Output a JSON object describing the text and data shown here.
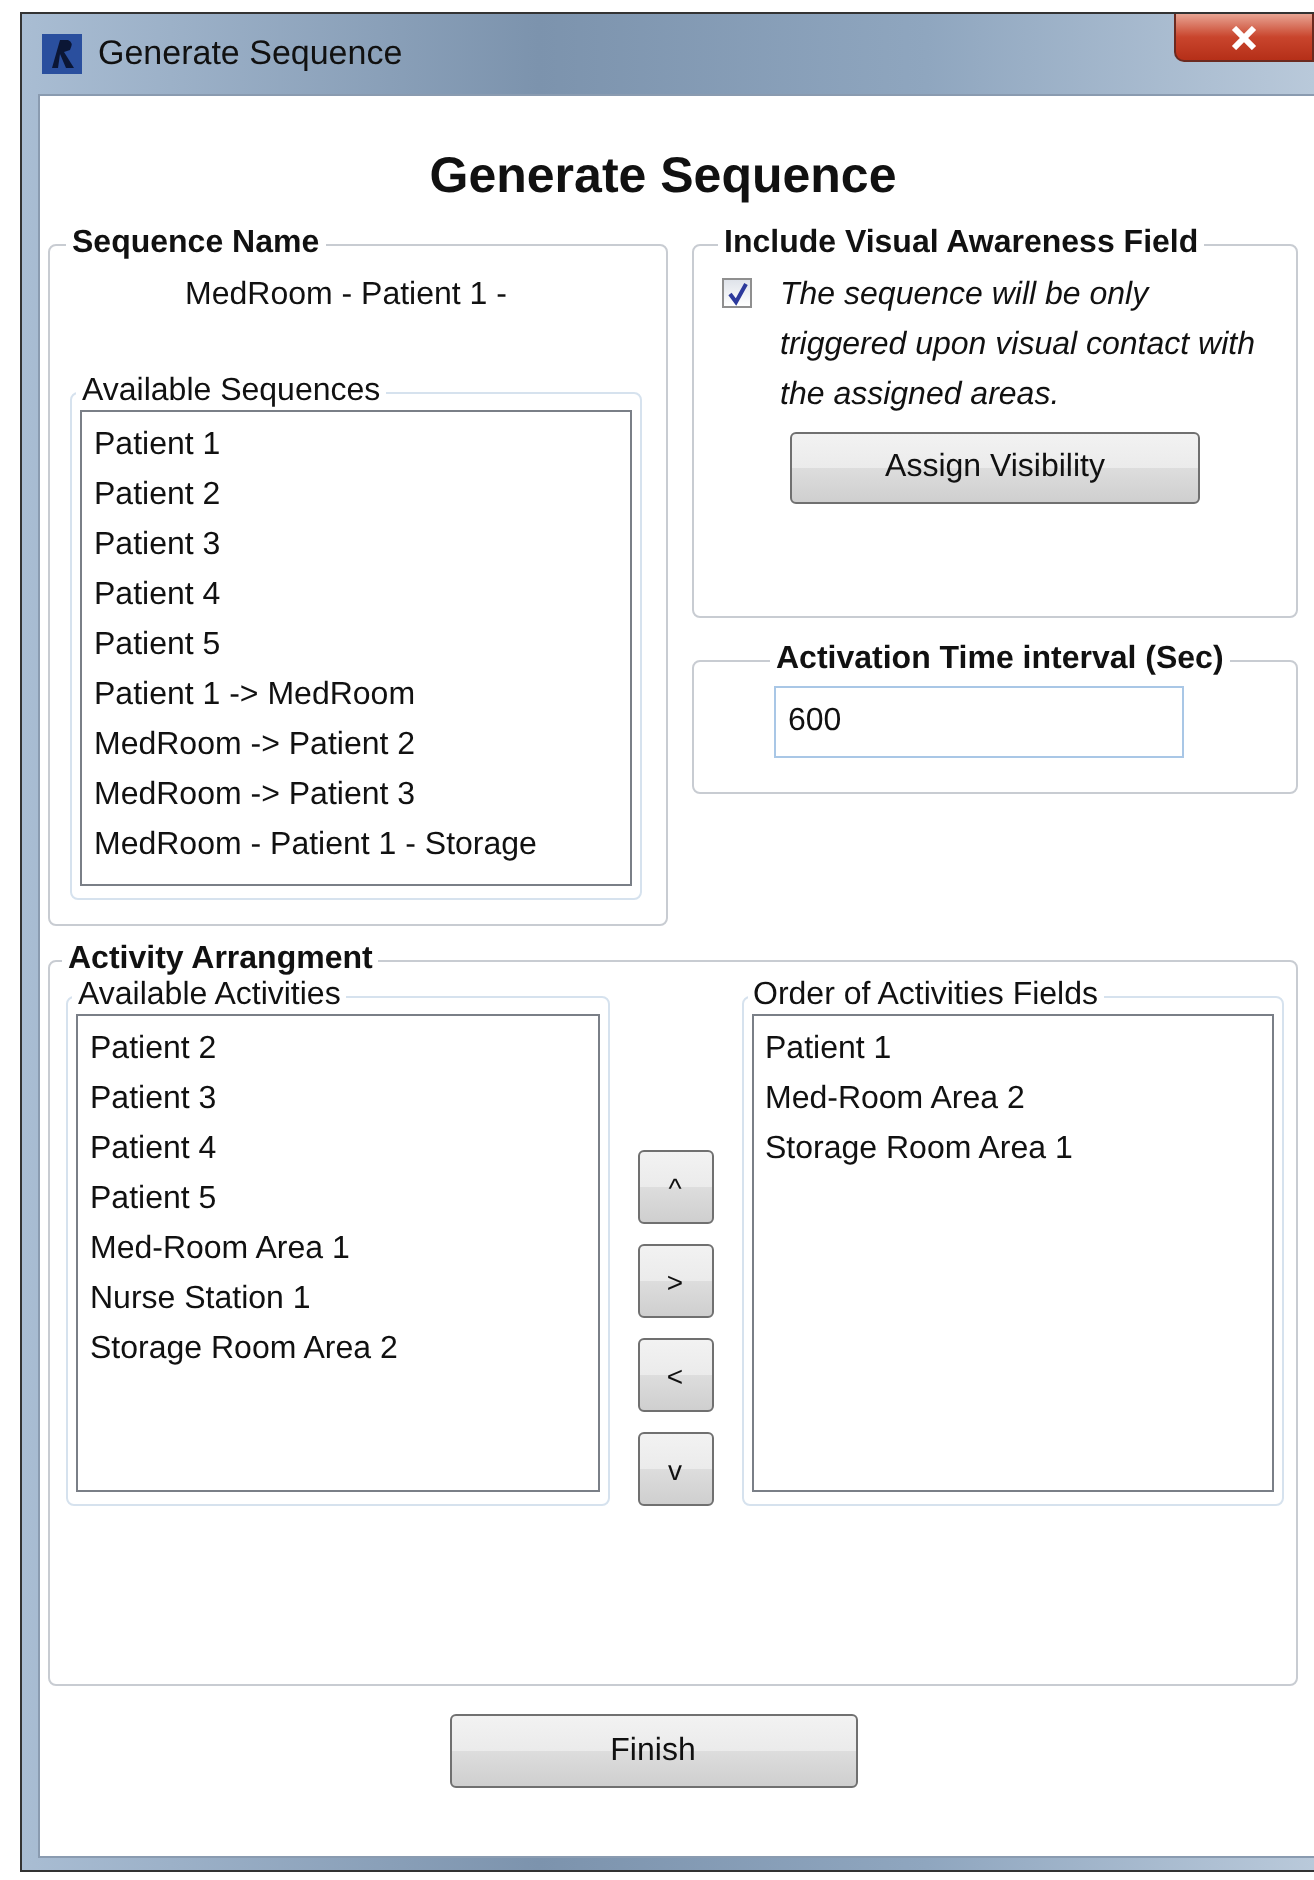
{
  "window": {
    "title": "Generate Sequence"
  },
  "heading": "Generate Sequence",
  "sequence_name": {
    "label": "Sequence Name",
    "value": "MedRoom - Patient 1 -",
    "available_sequences": {
      "label": "Available Sequences",
      "items": [
        "Patient 1",
        "Patient 2",
        "Patient 3",
        "Patient 4",
        "Patient 5",
        "Patient 1 -> MedRoom",
        "MedRoom -> Patient 2",
        "MedRoom -> Patient 3",
        "MedRoom - Patient 1 - Storage"
      ]
    }
  },
  "visual_awareness": {
    "label": "Include Visual Awareness Field",
    "checked": true,
    "description": "The sequence will be only triggered upon visual contact with the assigned areas.",
    "button": "Assign Visibility"
  },
  "activation": {
    "label": "Activation Time interval (Sec)",
    "value": "600"
  },
  "activity_arrangement": {
    "label": "Activity Arrangment",
    "available": {
      "label": "Available Activities",
      "items": [
        "Patient 2",
        "Patient 3",
        "Patient 4",
        "Patient 5",
        "Med-Room Area 1",
        "Nurse Station 1",
        "Storage Room Area 2"
      ]
    },
    "move_buttons": [
      "^",
      ">",
      "<",
      "v"
    ],
    "order": {
      "label": "Order of Activities Fields",
      "items": [
        "Patient 1",
        "Med-Room Area 2",
        "Storage Room Area 1"
      ]
    }
  },
  "finish_button": "Finish"
}
